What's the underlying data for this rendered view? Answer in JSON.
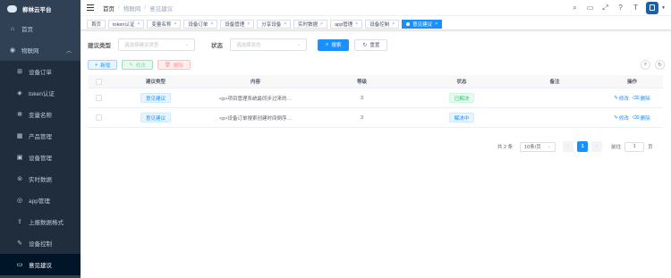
{
  "app": {
    "title": "柳林云平台"
  },
  "sidebar": {
    "home": "首页",
    "group": "物联网",
    "items": [
      {
        "label": "设备订单",
        "icon": "order-icon"
      },
      {
        "label": "token认证",
        "icon": "shield-icon"
      },
      {
        "label": "变量名称",
        "icon": "gear-icon"
      },
      {
        "label": "产品管理",
        "icon": "grid-icon"
      },
      {
        "label": "设备管理",
        "icon": "device-icon"
      },
      {
        "label": "实时数据",
        "icon": "data-icon"
      },
      {
        "label": "app管理",
        "icon": "app-icon"
      },
      {
        "label": "上报数据格式",
        "icon": "upload-icon"
      },
      {
        "label": "设备控制",
        "icon": "control-icon"
      },
      {
        "label": "意见建议",
        "icon": "feedback-icon",
        "active": true
      }
    ]
  },
  "breadcrumb": [
    "首页",
    "物联网",
    "意见建议"
  ],
  "tags": [
    "首页",
    "token认证",
    "变量名称",
    "设备订单",
    "设备管理",
    "分享设备",
    "实时数据",
    "app管理",
    "设备控制",
    "意见建议"
  ],
  "search": {
    "type_label": "建议类型",
    "type_placeholder": "请选择建议类型",
    "status_label": "状态",
    "status_placeholder": "请选择状态",
    "search_btn": "搜索",
    "reset_btn": "重置"
  },
  "toolbar": {
    "add": "新增",
    "edit": "修改",
    "delete": "删除"
  },
  "table": {
    "headers": [
      "建议类型",
      "内容",
      "等级",
      "状态",
      "备注",
      "操作"
    ],
    "rows": [
      {
        "type": "意见建议",
        "content": "<p>项目管理系统最同步过来的…",
        "level": "3",
        "status": "已解决",
        "remark": "",
        "edit": "修改",
        "delete": "删除"
      },
      {
        "type": "意见建议",
        "content": "<p>设备订单搜索创建时间倒序…",
        "level": "3",
        "status": "解决中",
        "remark": "",
        "edit": "修改",
        "delete": "删除"
      }
    ]
  },
  "pagination": {
    "total": "共 2 条",
    "page_size": "10条/页",
    "current": "1",
    "goto_label": "前往",
    "goto_value": "1",
    "page_suffix": "页"
  },
  "colors": {
    "primary": "#1890ff",
    "sidebar": "#304156",
    "sidebar_sub": "#1f2d3d"
  }
}
